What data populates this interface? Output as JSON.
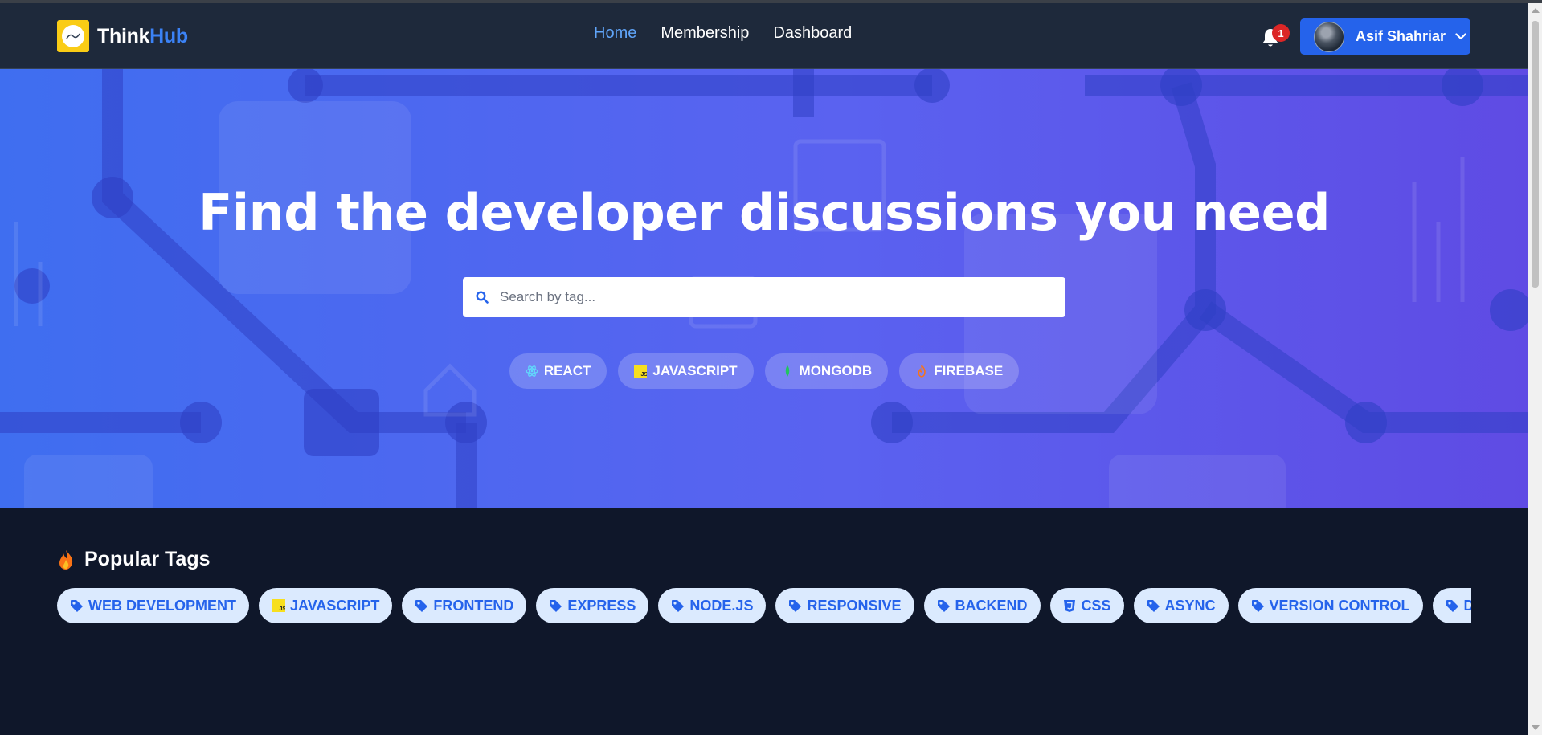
{
  "brand": {
    "part1": "Think",
    "part2": "Hub",
    "logo_icon": "brand-logo-icon"
  },
  "nav": {
    "links": [
      {
        "label": "Home",
        "active": true
      },
      {
        "label": "Membership",
        "active": false
      },
      {
        "label": "Dashboard",
        "active": false
      }
    ]
  },
  "notifications": {
    "count": "1",
    "icon": "bell-icon"
  },
  "user": {
    "name": "Asif Shahriar",
    "icon": "chevron-down-icon"
  },
  "hero": {
    "title": "Find the developer discussions you need",
    "search_placeholder": "Search by tag...",
    "quick_tags": [
      {
        "label": "REACT",
        "icon": "react-icon"
      },
      {
        "label": "JAVASCRIPT",
        "icon": "javascript-icon"
      },
      {
        "label": "MONGODB",
        "icon": "mongodb-icon"
      },
      {
        "label": "FIREBASE",
        "icon": "firebase-icon"
      }
    ]
  },
  "popular": {
    "title": "Popular Tags",
    "tags": [
      {
        "label": "WEB DEVELOPMENT",
        "icon": "tag-icon"
      },
      {
        "label": "JAVASCRIPT",
        "icon": "javascript-icon"
      },
      {
        "label": "FRONTEND",
        "icon": "tag-icon"
      },
      {
        "label": "EXPRESS",
        "icon": "tag-icon"
      },
      {
        "label": "NODE.JS",
        "icon": "tag-icon"
      },
      {
        "label": "RESPONSIVE",
        "icon": "tag-icon"
      },
      {
        "label": "BACKEND",
        "icon": "tag-icon"
      },
      {
        "label": "CSS",
        "icon": "css-icon"
      },
      {
        "label": "ASYNC",
        "icon": "tag-icon"
      },
      {
        "label": "VERSION CONTROL",
        "icon": "tag-icon"
      },
      {
        "label": "DATABASE",
        "icon": "tag-icon"
      }
    ]
  },
  "colors": {
    "navbar": "#1e293b",
    "page_bg": "#0f172a",
    "accent": "#2563eb",
    "nav_active": "#60a5fa",
    "tag_bg": "#dbeafe",
    "hero_start": "#3f6ef0",
    "hero_end": "#5f4be4"
  }
}
